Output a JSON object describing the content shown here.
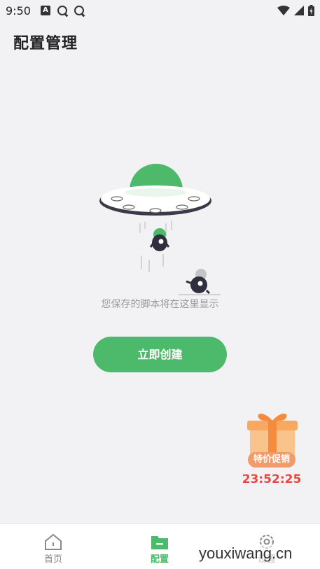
{
  "status_bar": {
    "time": "9:50",
    "notification_icons": [
      "a-icon",
      "q-icon",
      "q-icon"
    ],
    "system_icons": [
      "wifi-icon",
      "signal-icon",
      "battery-icon"
    ]
  },
  "header": {
    "title": "配置管理"
  },
  "empty_state": {
    "message": "您保存的脚本将在这里显示",
    "button_label": "立即创建",
    "illustration": "ufo-illustration"
  },
  "promo": {
    "badge_label": "特价促销",
    "timer": "23:52:25",
    "icon": "gift-box-icon"
  },
  "bottom_nav": {
    "items": [
      {
        "label": "首页",
        "icon": "home-icon",
        "active": false
      },
      {
        "label": "配置",
        "icon": "folder-icon",
        "active": true
      },
      {
        "label": "设置",
        "icon": "gear-icon",
        "active": false
      }
    ]
  },
  "watermark": "youxiwang.cn",
  "colors": {
    "accent": "#4cba6a",
    "background": "#f2f2f4",
    "timer": "#e8483b",
    "promo_badge": "#f29a6a"
  }
}
